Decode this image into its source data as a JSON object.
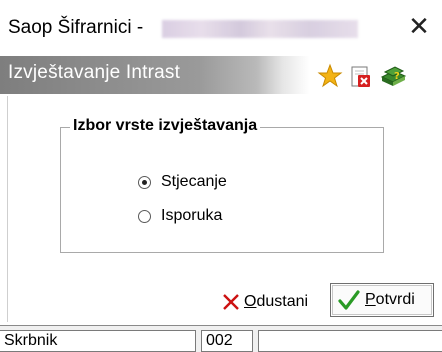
{
  "window": {
    "title": "Saop Šifrarnici -",
    "close_symbol": "✕"
  },
  "header": {
    "title": "Izvještavanje Intrast",
    "icons": [
      "star-icon",
      "delete-document-icon",
      "help-books-icon"
    ]
  },
  "dialog": {
    "group_title": "Izbor vrste izvještavanja",
    "options": [
      {
        "label": "Stjecanje",
        "selected": true
      },
      {
        "label": "Isporuka",
        "selected": false
      }
    ]
  },
  "buttons": {
    "cancel_accesskey": "O",
    "cancel_rest": "dustani",
    "ok_accesskey": "P",
    "ok_rest": "otvrdi"
  },
  "statusbar": {
    "cells": [
      "Skrbnik",
      "002",
      ""
    ]
  },
  "colors": {
    "cancel_x": "#cc1111",
    "ok_check": "#2a9a25",
    "star": "#f3b315"
  }
}
